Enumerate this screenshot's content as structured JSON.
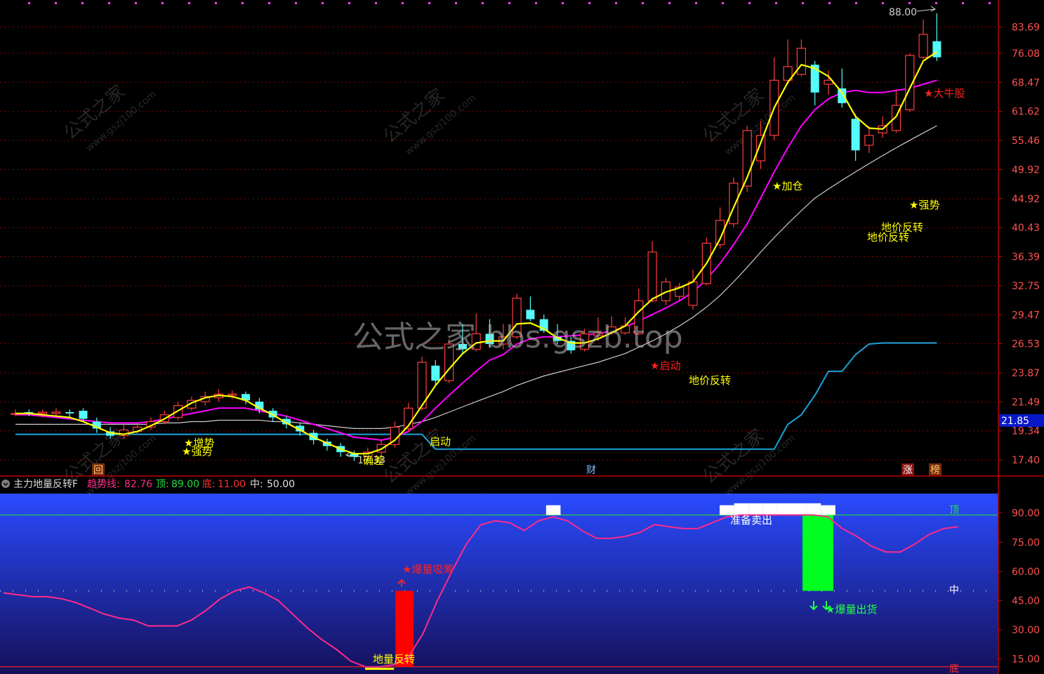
{
  "watermark": {
    "main_text": "公式之家 bbs.gszb.top",
    "tile_cn": "公式之家",
    "tile_url": "www.gszj100.com"
  },
  "colors": {
    "background": "#000000",
    "axis": "#c00000",
    "grid": "#8b0000",
    "up_candle": "#ff3c3c",
    "down_candle": "#54fcfc",
    "ma_fast": "#ffff00",
    "ma_mid": "#ff00ff",
    "ma_slow": "#cccccc",
    "support_line": "#1aa3d8",
    "indicator_bg_top": "#1e3cff",
    "indicator_bg_bottom": "#140c5c",
    "trend_line": "#ff2a8a",
    "top_line": "#22cc44",
    "bottom_line": "#ff2020",
    "mid_line": "#e0e0e0"
  },
  "price_panel": {
    "y_axis_labels": [
      "83.69",
      "76.08",
      "68.47",
      "61.62",
      "55.46",
      "49.92",
      "44.92",
      "40.43",
      "36.39",
      "32.75",
      "29.47",
      "26.53",
      "23.87",
      "21.49",
      "19.34",
      "17.40"
    ],
    "current_price_tag": "21.85",
    "max_label": "88.00",
    "min_label": "17.33",
    "annotations": [
      {
        "text": "★加仓",
        "color": "#ffff00"
      },
      {
        "text": "★强势",
        "color": "#ffff00"
      },
      {
        "text": "地价反转",
        "color": "#ffff00"
      },
      {
        "text": "地价反转",
        "color": "#ffff00"
      },
      {
        "text": "地价反转",
        "color": "#ffff00"
      },
      {
        "text": "★大牛股",
        "color": "#ff2020"
      },
      {
        "text": "★强势",
        "color": "#ffff00"
      },
      {
        "text": "★增势",
        "color": "#ffff00"
      },
      {
        "text": "★启动",
        "color": "#ff2020"
      },
      {
        "text": "启动",
        "color": "#ffff00"
      },
      {
        "text": "确差",
        "color": "#ffff00"
      }
    ],
    "bottom_tags": [
      {
        "text": "回",
        "color": "#ffcc66",
        "bg": "#7a2a10"
      },
      {
        "text": "财",
        "color": "#80c0ff",
        "bg": "#000000"
      },
      {
        "text": "涨",
        "color": "#ffffff",
        "bg": "#8a1010"
      },
      {
        "text": "榜",
        "color": "#ffcc66",
        "bg": "#7a2a10"
      }
    ]
  },
  "indicator_panel": {
    "title": "主力地量反转F",
    "trend_label": "趋势线:",
    "trend_value": "82.76",
    "top_label": "顶:",
    "top_value": "89.00",
    "bottom_label": "底:",
    "bottom_value": "11.00",
    "mid_label": "中:",
    "mid_value": "50.00",
    "y_axis_labels": [
      "90.00",
      "75.00",
      "60.00",
      "45.00",
      "30.00",
      "15.00"
    ],
    "right_tags": {
      "top": "顶",
      "mid": "中",
      "bottom": "底"
    },
    "annotations": {
      "buy_signal": "★爆量吸筹",
      "sell_signal": "★爆量出货",
      "prepare_sell": "准备卖出",
      "ground_reversal": "地量反转"
    }
  },
  "chart_data": [
    {
      "type": "candlestick",
      "title": "",
      "y_scale": "log",
      "ylim": [
        16.5,
        90
      ],
      "x_count": 54,
      "candles": [
        {
          "o": 20.6,
          "c": 20.6,
          "h": 20.9,
          "l": 20.4
        },
        {
          "o": 20.7,
          "c": 20.6,
          "h": 20.9,
          "l": 20.4
        },
        {
          "o": 20.6,
          "c": 20.7,
          "h": 20.9,
          "l": 20.3
        },
        {
          "o": 20.6,
          "c": 20.7,
          "h": 21.0,
          "l": 20.4
        },
        {
          "o": 20.7,
          "c": 20.6,
          "h": 20.9,
          "l": 20.3
        },
        {
          "o": 20.8,
          "c": 20.2,
          "h": 21.0,
          "l": 20.0
        },
        {
          "o": 20.0,
          "c": 19.5,
          "h": 20.3,
          "l": 19.2
        },
        {
          "o": 19.3,
          "c": 19.0,
          "h": 19.6,
          "l": 18.8
        },
        {
          "o": 19.0,
          "c": 19.4,
          "h": 19.8,
          "l": 18.8
        },
        {
          "o": 19.3,
          "c": 19.6,
          "h": 19.9,
          "l": 19.1
        },
        {
          "o": 19.6,
          "c": 20.0,
          "h": 20.3,
          "l": 19.4
        },
        {
          "o": 20.0,
          "c": 20.5,
          "h": 20.8,
          "l": 19.8
        },
        {
          "o": 20.3,
          "c": 21.2,
          "h": 21.5,
          "l": 20.1
        },
        {
          "o": 21.0,
          "c": 21.6,
          "h": 21.9,
          "l": 20.8
        },
        {
          "o": 21.5,
          "c": 21.9,
          "h": 22.3,
          "l": 21.2
        },
        {
          "o": 21.8,
          "c": 22.1,
          "h": 22.5,
          "l": 21.5
        },
        {
          "o": 22.0,
          "c": 22.1,
          "h": 22.4,
          "l": 21.7
        },
        {
          "o": 22.1,
          "c": 21.6,
          "h": 22.3,
          "l": 21.3
        },
        {
          "o": 21.5,
          "c": 20.9,
          "h": 21.8,
          "l": 20.6
        },
        {
          "o": 20.8,
          "c": 20.3,
          "h": 21.0,
          "l": 20.0
        },
        {
          "o": 20.2,
          "c": 19.8,
          "h": 20.4,
          "l": 19.5
        },
        {
          "o": 19.7,
          "c": 19.3,
          "h": 19.9,
          "l": 19.0
        },
        {
          "o": 19.2,
          "c": 18.7,
          "h": 19.4,
          "l": 18.4
        },
        {
          "o": 18.6,
          "c": 18.3,
          "h": 18.8,
          "l": 18.0
        },
        {
          "o": 18.3,
          "c": 17.9,
          "h": 18.5,
          "l": 17.6
        },
        {
          "o": 17.8,
          "c": 17.6,
          "h": 18.0,
          "l": 17.33
        },
        {
          "o": 17.6,
          "c": 17.9,
          "h": 18.2,
          "l": 17.4
        },
        {
          "o": 17.9,
          "c": 18.4,
          "h": 18.7,
          "l": 17.7
        },
        {
          "o": 18.4,
          "c": 19.6,
          "h": 20.0,
          "l": 18.2
        },
        {
          "o": 19.5,
          "c": 21.0,
          "h": 21.4,
          "l": 19.3
        },
        {
          "o": 21.0,
          "c": 24.8,
          "h": 25.3,
          "l": 20.8
        },
        {
          "o": 24.5,
          "c": 23.2,
          "h": 25.0,
          "l": 22.8
        },
        {
          "o": 23.2,
          "c": 26.5,
          "h": 27.0,
          "l": 23.0
        },
        {
          "o": 26.5,
          "c": 26.0,
          "h": 28.5,
          "l": 25.6
        },
        {
          "o": 26.0,
          "c": 27.5,
          "h": 29.6,
          "l": 25.8
        },
        {
          "o": 27.5,
          "c": 26.5,
          "h": 29.0,
          "l": 26.2
        },
        {
          "o": 26.5,
          "c": 27.2,
          "h": 28.5,
          "l": 26.0
        },
        {
          "o": 27.2,
          "c": 31.3,
          "h": 31.8,
          "l": 27.0
        },
        {
          "o": 30.0,
          "c": 29.0,
          "h": 31.5,
          "l": 28.8
        },
        {
          "o": 29.0,
          "c": 27.8,
          "h": 29.5,
          "l": 27.6
        },
        {
          "o": 27.2,
          "c": 26.8,
          "h": 28.5,
          "l": 26.5
        },
        {
          "o": 26.8,
          "c": 25.9,
          "h": 27.2,
          "l": 25.6
        },
        {
          "o": 26.0,
          "c": 27.5,
          "h": 28.0,
          "l": 25.8
        },
        {
          "o": 27.3,
          "c": 27.6,
          "h": 29.2,
          "l": 26.8
        },
        {
          "o": 27.6,
          "c": 28.2,
          "h": 29.3,
          "l": 27.4
        },
        {
          "o": 27.6,
          "c": 28.3,
          "h": 29.2,
          "l": 27.4
        },
        {
          "o": 27.5,
          "c": 31.0,
          "h": 32.4,
          "l": 27.4
        },
        {
          "o": 31.0,
          "c": 37.0,
          "h": 38.5,
          "l": 30.8
        },
        {
          "o": 31.0,
          "c": 33.2,
          "h": 33.7,
          "l": 30.5
        },
        {
          "o": 31.5,
          "c": 32.6,
          "h": 33.1,
          "l": 31.0
        },
        {
          "o": 30.5,
          "c": 33.2,
          "h": 34.7,
          "l": 30.0
        },
        {
          "o": 33.0,
          "c": 38.2,
          "h": 39.0,
          "l": 32.8
        },
        {
          "o": 38.0,
          "c": 41.5,
          "h": 43.5,
          "l": 37.5
        },
        {
          "o": 41.0,
          "c": 47.5,
          "h": 48.5,
          "l": 40.5
        },
        {
          "o": 47.0,
          "c": 57.5,
          "h": 58.5,
          "l": 46.0
        },
        {
          "o": 51.5,
          "c": 56.5,
          "h": 59.5,
          "l": 50.0
        },
        {
          "o": 56.5,
          "c": 69.0,
          "h": 75.0,
          "l": 55.5
        },
        {
          "o": 69.0,
          "c": 72.5,
          "h": 80.0,
          "l": 68.0
        },
        {
          "o": 70.5,
          "c": 77.5,
          "h": 80.0,
          "l": 70.0
        },
        {
          "o": 73.0,
          "c": 66.0,
          "h": 74.0,
          "l": 63.0
        },
        {
          "o": 68.0,
          "c": 69.0,
          "h": 71.5,
          "l": 65.5
        },
        {
          "o": 67.0,
          "c": 63.5,
          "h": 72.0,
          "l": 62.5
        },
        {
          "o": 60.0,
          "c": 53.5,
          "h": 61.0,
          "l": 51.5
        },
        {
          "o": 54.5,
          "c": 56.5,
          "h": 58.5,
          "l": 53.0
        },
        {
          "o": 57.0,
          "c": 58.5,
          "h": 60.5,
          "l": 56.0
        },
        {
          "o": 57.5,
          "c": 63.0,
          "h": 66.5,
          "l": 57.0
        },
        {
          "o": 62.0,
          "c": 75.5,
          "h": 76.0,
          "l": 61.5
        },
        {
          "o": 75.0,
          "c": 81.5,
          "h": 86.0,
          "l": 74.5
        },
        {
          "o": 79.5,
          "c": 75.0,
          "h": 88.0,
          "l": 74.0
        }
      ],
      "ma_fast": [
        20.6,
        20.6,
        20.5,
        20.4,
        20.3,
        20.0,
        19.6,
        19.2,
        19.1,
        19.3,
        19.7,
        20.2,
        20.8,
        21.4,
        21.8,
        22.0,
        21.9,
        21.6,
        21.0,
        20.5,
        19.9,
        19.4,
        18.9,
        18.5,
        18.1,
        17.8,
        17.8,
        18.1,
        18.7,
        19.7,
        21.2,
        22.8,
        24.2,
        25.6,
        26.6,
        26.8,
        26.8,
        28.5,
        28.6,
        28.0,
        27.1,
        26.6,
        26.6,
        27.0,
        27.6,
        28.3,
        29.8,
        31.2,
        32.0,
        32.5,
        33.2,
        35.5,
        38.8,
        43.5,
        48.5,
        55.0,
        62.5,
        68.5,
        73.0,
        72.0,
        70.0,
        66.0,
        60.5,
        58.0,
        57.8,
        60.5,
        67.0,
        74.0,
        76.5
      ],
      "ma_mid": [
        20.5,
        20.5,
        20.4,
        20.3,
        20.2,
        20.1,
        20.0,
        19.9,
        19.9,
        19.9,
        20.0,
        20.2,
        20.4,
        20.6,
        20.8,
        21.0,
        21.0,
        21.0,
        20.8,
        20.6,
        20.4,
        20.1,
        19.8,
        19.5,
        19.2,
        18.9,
        18.8,
        18.7,
        18.9,
        19.3,
        20.0,
        21.0,
        22.0,
        23.0,
        24.0,
        25.0,
        25.5,
        26.5,
        27.0,
        27.2,
        27.2,
        27.3,
        27.4,
        27.5,
        27.8,
        28.2,
        28.8,
        29.5,
        30.2,
        31.0,
        32.0,
        33.5,
        35.5,
        38.0,
        41.0,
        45.0,
        49.5,
        54.0,
        58.5,
        62.0,
        64.5,
        66.0,
        66.5,
        66.0,
        66.0,
        66.5,
        67.0,
        68.0,
        69.0
      ],
      "ma_slow": [
        19.8,
        19.8,
        19.8,
        19.8,
        19.8,
        19.8,
        19.8,
        19.8,
        19.8,
        19.8,
        19.8,
        19.9,
        19.9,
        20.0,
        20.0,
        20.1,
        20.1,
        20.1,
        20.1,
        20.0,
        20.0,
        19.9,
        19.8,
        19.7,
        19.6,
        19.5,
        19.5,
        19.5,
        19.6,
        19.8,
        20.0,
        20.3,
        20.7,
        21.1,
        21.5,
        21.9,
        22.3,
        22.8,
        23.2,
        23.6,
        23.9,
        24.2,
        24.5,
        24.8,
        25.2,
        25.6,
        26.2,
        26.8,
        27.5,
        28.3,
        29.2,
        30.3,
        31.6,
        33.2,
        35.0,
        37.0,
        39.0,
        41.0,
        43.0,
        45.0,
        46.5,
        48.0,
        49.5,
        51.0,
        52.5,
        54.0,
        55.5,
        57.0,
        58.5
      ],
      "support_line": [
        19.1,
        19.1,
        19.1,
        19.1,
        19.1,
        19.1,
        19.1,
        19.1,
        19.1,
        19.1,
        19.1,
        19.1,
        19.1,
        19.1,
        19.1,
        19.1,
        19.1,
        19.1,
        19.1,
        19.1,
        19.1,
        19.1,
        19.1,
        19.1,
        19.1,
        19.1,
        19.1,
        19.1,
        19.1,
        19.1,
        19.1,
        18.1,
        18.1,
        18.1,
        18.1,
        18.1,
        18.1,
        18.1,
        18.1,
        18.1,
        18.1,
        18.1,
        18.1,
        18.1,
        18.1,
        18.1,
        18.1,
        18.1,
        18.1,
        18.1,
        18.1,
        18.1,
        18.1,
        18.1,
        18.1,
        18.1,
        18.1,
        19.8,
        20.5,
        22.0,
        24.0,
        24.0,
        25.5,
        26.5,
        26.6,
        26.6,
        26.6,
        26.6,
        26.6
      ]
    },
    {
      "type": "line",
      "title": "主力地量反转F",
      "ylim": [
        8,
        100
      ],
      "series": [
        {
          "name": "趋势线",
          "values": [
            49,
            48,
            47,
            47,
            46,
            44,
            41,
            38,
            36,
            35,
            32,
            32,
            32,
            35,
            40,
            46,
            50,
            52,
            49,
            45,
            38,
            31,
            25,
            20,
            14,
            11,
            11,
            12,
            16,
            28,
            45,
            60,
            74,
            84,
            86,
            85,
            81,
            86,
            88,
            86,
            81,
            77,
            77,
            78,
            80,
            84,
            83,
            82,
            82,
            85,
            88,
            89,
            89,
            89,
            89,
            89,
            89,
            88,
            82,
            78,
            73,
            70,
            70,
            74,
            79,
            82,
            83
          ]
        },
        {
          "name": "顶",
          "values": [
            89
          ]
        },
        {
          "name": "底",
          "values": [
            11
          ]
        },
        {
          "name": "中",
          "values": [
            50
          ]
        }
      ],
      "signal_bars": [
        {
          "label": "★爆量吸筹",
          "from": 11,
          "to": 50,
          "color": "#ff0000"
        },
        {
          "label": "★爆量出货",
          "from": 50,
          "to": 89,
          "color": "#00ff20"
        }
      ]
    }
  ]
}
